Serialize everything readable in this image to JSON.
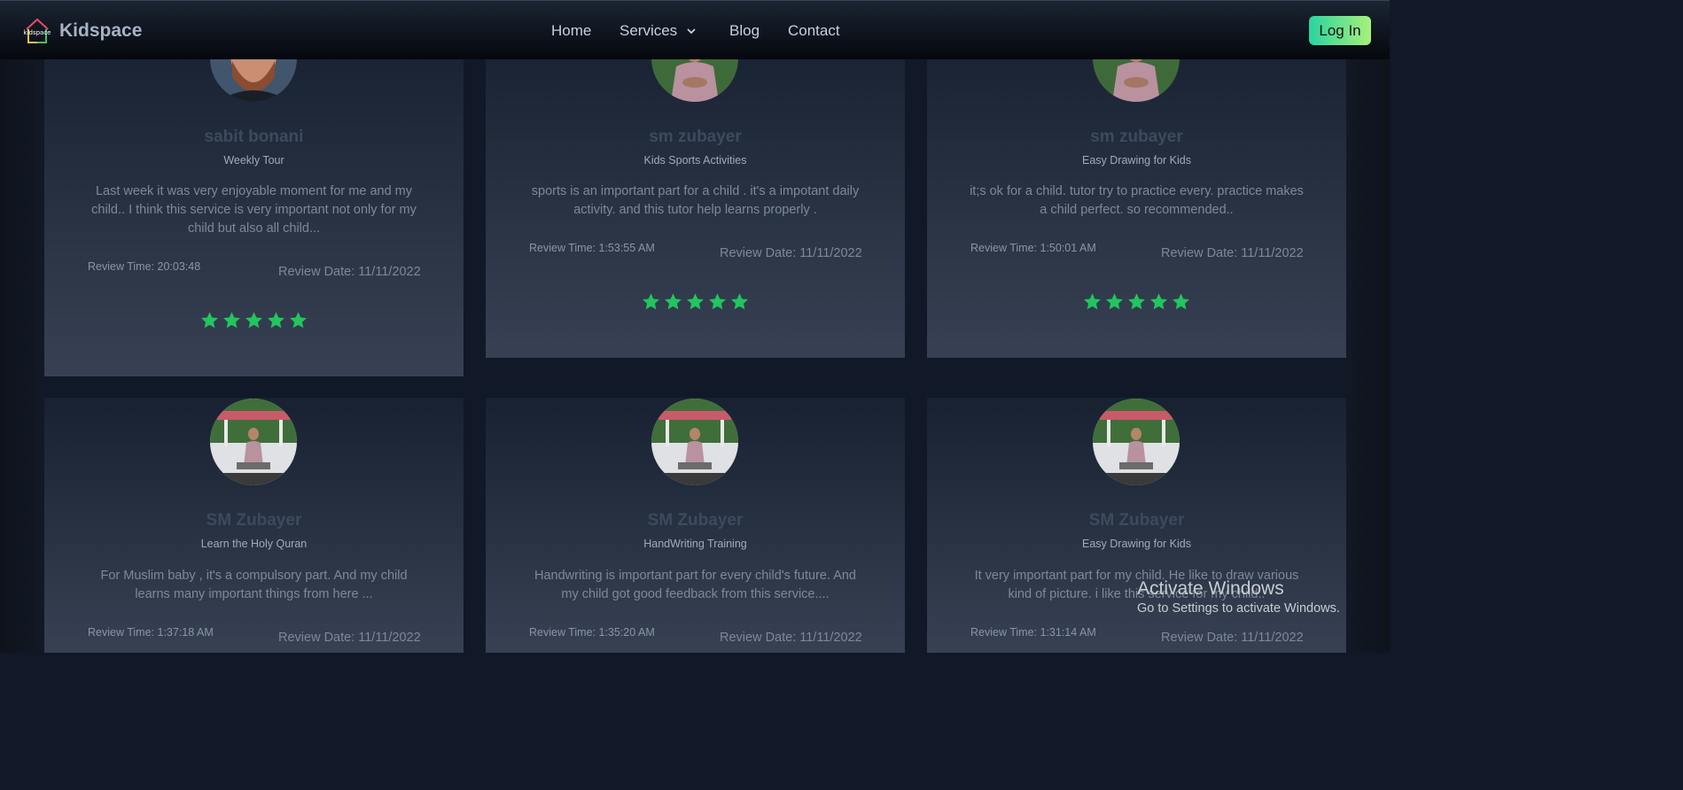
{
  "navbar": {
    "brand": "Kidspace",
    "logo_text": "kidspace",
    "links": [
      "Home",
      "Services",
      "Blog",
      "Contact"
    ],
    "login_label": "Log In"
  },
  "reviews": [
    {
      "name": "sabit bonani",
      "service": "Weekly Tour",
      "text": "Last week it was very enjoyable moment for me and my child.. I think this service is very important not only for my child but also all child...",
      "time": "Review Time: 20:03:48",
      "date": "Review Date: 11/11/2022",
      "rating": 5
    },
    {
      "name": "sm zubayer",
      "service": "Kids Sports Activities",
      "text": "sports is an important part for a child . it's a impotant daily activity. and this tutor help learns properly .",
      "time": "Review Time: 1:53:55 AM",
      "date": "Review Date: 11/11/2022",
      "rating": 5
    },
    {
      "name": "sm zubayer",
      "service": "Easy Drawing for Kids",
      "text": "it;s ok for a child. tutor try to practice every. practice makes a child perfect. so recommended..",
      "time": "Review Time: 1:50:01 AM",
      "date": "Review Date: 11/11/2022",
      "rating": 5
    },
    {
      "name": "SM Zubayer",
      "service": "Learn the Holy Quran",
      "text": "For Muslim baby , it's a compulsory part. And my child learns many important things from here ...",
      "time": "Review Time: 1:37:18 AM",
      "date": "Review Date: 11/11/2022"
    },
    {
      "name": "SM Zubayer",
      "service": "HandWriting Training",
      "text": "Handwriting is important part for every child's future. And my child got good feedback from this service....",
      "time": "Review Time: 1:35:20 AM",
      "date": "Review Date: 11/11/2022"
    },
    {
      "name": "SM Zubayer",
      "service": "Easy Drawing for Kids",
      "text": "It very important part for my child. He like to draw various kind of picture. i like this service for my child..",
      "time": "Review Time: 1:31:14 AM",
      "date": "Review Date: 11/11/2022"
    }
  ],
  "watermark": {
    "title": "Activate Windows",
    "subtitle": "Go to Settings to activate Windows."
  },
  "colors": {
    "star": "#22c55e",
    "accent_from": "#2ad4a0",
    "accent_to": "#a8f07a"
  }
}
